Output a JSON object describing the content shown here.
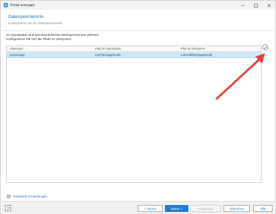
{
  "window": {
    "title": "Portal erzeugen"
  },
  "header": {
    "title": "Dateispeicherorte",
    "subtitle": "Konfigurieren Sie die Dateispeicherorte"
  },
  "content": {
    "description_line1": "Im Importpaket sind benutzerdefinierte Dateispeicherorte definiert.",
    "description_line2": "Konfigurieren Sie hier die Pfade im Zielsystem."
  },
  "table": {
    "columns": [
      "Aliasname",
      "Pfad im Importpaket",
      "Pfad im Zielsystem"
    ],
    "rows": [
      {
        "alias": "myStorage",
        "package_path": "myFiles\\{appGuid}",
        "target_path": "Internal\\files\\{appGuid}"
      }
    ]
  },
  "advanced_settings_label": "Erweiterte Einstellungen",
  "footer": {
    "back": "< Zurück",
    "next": "Weiter >",
    "finish": "Fertigstellen",
    "cancel": "Abbrechen",
    "help": "Hilfe"
  },
  "colors": {
    "accent": "#1a7fd4",
    "selection": "#cfe8f7",
    "annotation_arrow": "#e8413b"
  }
}
